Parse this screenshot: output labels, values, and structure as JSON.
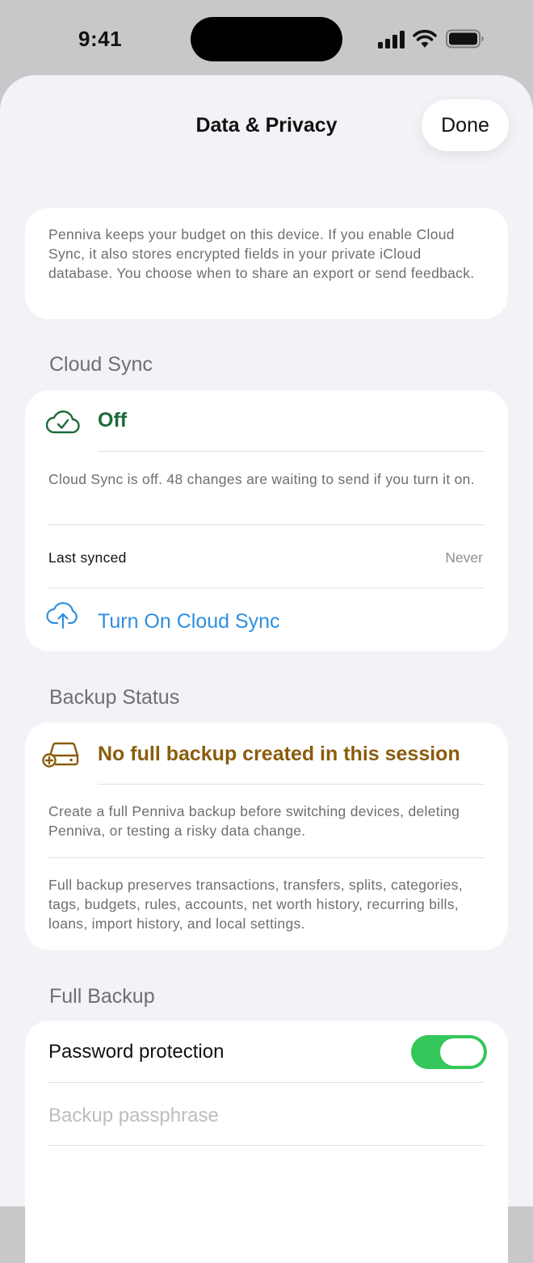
{
  "status_bar": {
    "time": "9:41"
  },
  "sheet": {
    "title": "Data & Privacy",
    "done_label": "Done"
  },
  "intro": {
    "text": "Penniva keeps your budget on this device. If you enable Cloud Sync, it also stores encrypted fields in your private iCloud database. You choose when to share an export or send feedback."
  },
  "cloud_sync": {
    "header": "Cloud Sync",
    "status": "Off",
    "status_icon": "cloud-check-icon",
    "description": "Cloud Sync is off. 48 changes are waiting to send if you turn it on.",
    "last_synced_label": "Last synced",
    "last_synced_value": "Never",
    "action_label": "Turn On Cloud Sync",
    "action_icon": "cloud-upload-icon"
  },
  "backup_status": {
    "header": "Backup Status",
    "warning": "No full backup created in this session",
    "warning_icon": "drive-add-icon",
    "description": "Create a full Penniva backup before switching devices, deleting Penniva, or testing a risky data change.",
    "detail": "Full backup preserves transactions, transfers, splits, categories, tags, budgets, rules, accounts, net worth history, recurring bills, loans, import history, and local settings."
  },
  "full_backup": {
    "header": "Full Backup",
    "password_label": "Password protection",
    "password_enabled": true,
    "passphrase_placeholder": "Backup passphrase",
    "passphrase_value": ""
  },
  "colors": {
    "sync_status": "#1d6b3a",
    "action": "#2e8ee0",
    "warning": "#8a5c0e",
    "toggle_on": "#34c759"
  }
}
